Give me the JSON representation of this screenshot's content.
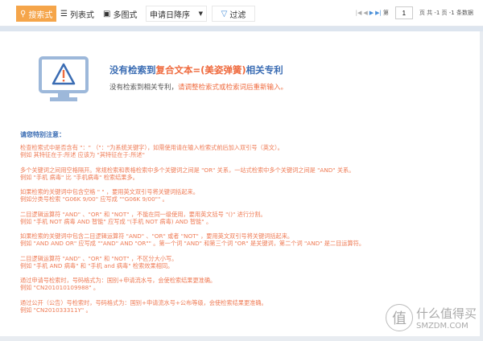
{
  "toolbar": {
    "search_mode": "搜索式",
    "list_mode": "列表式",
    "gallery_mode": "多图式",
    "sort": "申请日降序",
    "filter": "过滤"
  },
  "pager": {
    "prefix": "第",
    "page": "1",
    "suffix": "页 共 -1 页 -1 条数据"
  },
  "message": {
    "title_pre": "没有检索到",
    "title_hl": "复合文本=(美姿弹簧)",
    "title_post": "相关专利",
    "sub_pre": "没有检索到相关专利，",
    "sub_hl": "请调整检索式或检索词后重新输入。"
  },
  "notes": {
    "heading": "请您特别注意：",
    "items": [
      [
        "检查检索式中是否含有 \"：\" （\"：\"为系统关键字），如需使用请在输入检索式前后加入双引号（英文）。",
        "例如 其特征在于:所述 应该为 \"其特征在于:所述\""
      ],
      [
        "多个关键词之间用空格隔开。常规检索和表格检索中多个关键词之间是 \"OR\" 关系，一站式检索中多个关键词之间是 \"AND\" 关系。",
        "例如 \"手机 病毒\" 比 \"手机病毒\" 检索结果多。"
      ],
      [
        "如果检索的关键词中包含空格 \" \" ，要用英文双引号将关键词括起来。",
        "例如分类号检索 \"G06K 9/00\" 应写成 \"\"G06K 9/00\"\" 。"
      ],
      [
        "二目逻辑运算符 \"AND\" 、\"OR\" 和 \"NOT\" ，不能在同一级使用，要用英文括号 \"()\" 进行分割。",
        "例如 \"手机 NOT 病毒 AND 智能\" 应写成 \"(手机 NOT 病毒) AND 智能\" 。"
      ],
      [
        "如果检索的关键词中包含二目逻辑运算符 \"AND\" 、\"OR\" 或者 \"NOT\" ，要用英文双引号将关键词括起来。",
        "例如 \"AND AND OR\" 应写成 \"\"AND\" AND \"OR\"\" 。第一个词 \"AND\" 和第三个词 \"OR\" 是关键词，第二个词 \"AND\" 是二目运算符。"
      ],
      [
        "二目逻辑运算符 \"AND\" 、\"OR\" 和 \"NOT\" ，不区分大小写。",
        "例如 \"手机 AND 病毒\" 和 \"手机 and 病毒\" 检索效果相同。"
      ],
      [
        "通过申请号检索时，号码格式为：国别+申请流水号，会使检索结果更准确。",
        "例如 \"CN201010109988\" 。"
      ],
      [
        "通过公开（公告）号检索时，号码格式为：国别+申请流水号+公布等级，会使检索结果更准确。",
        "例如 \"CN201033311Y\" 。"
      ]
    ]
  },
  "watermark": {
    "cn": "什么值得买",
    "en": "SMZDM.COM",
    "seal": "值"
  }
}
